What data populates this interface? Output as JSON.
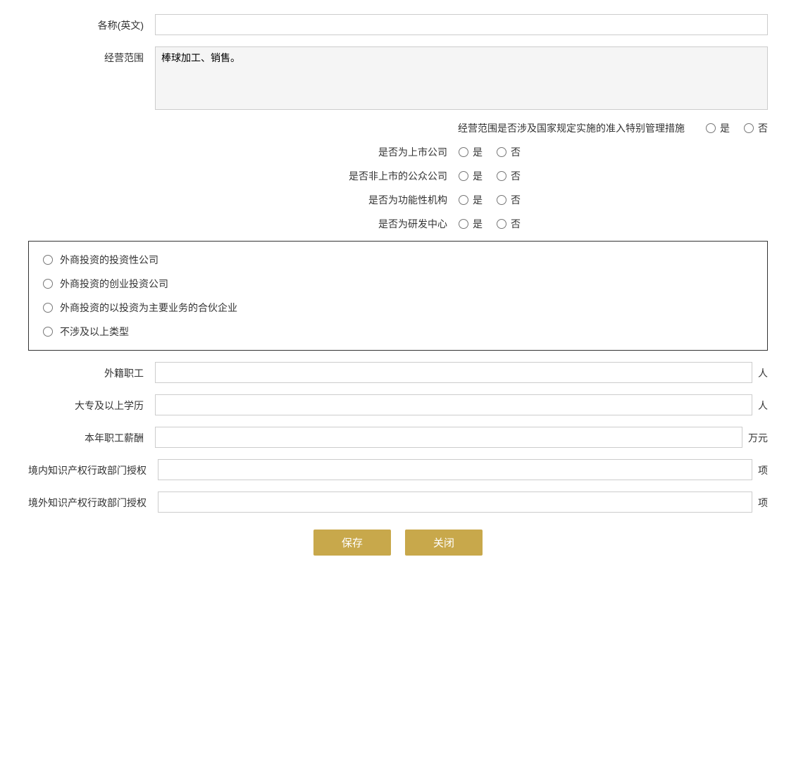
{
  "form": {
    "english_name_label": "各称(英文)",
    "english_name_value": "",
    "business_scope_label": "经营范围",
    "business_scope_value": "棒球加工、销售。",
    "special_mgmt_label": "经营范围是否涉及国家规定实施的准入特别管理措施",
    "special_mgmt_yes": "是",
    "special_mgmt_no": "否",
    "listed_company_label": "是否为上市公司",
    "listed_yes": "是",
    "listed_no": "否",
    "non_listed_public_label": "是否非上市的公众公司",
    "non_listed_yes": "是",
    "non_listed_no": "否",
    "functional_org_label": "是否为功能性机构",
    "functional_yes": "是",
    "functional_no": "否",
    "rd_center_label": "是否为研发中心",
    "rd_yes": "是",
    "rd_no": "否",
    "foreign_investment_options": [
      "外商投资的投资性公司",
      "外商投资的创业投资公司",
      "外商投资的以投资为主要业务的合伙企业",
      "不涉及以上类型"
    ],
    "foreign_staff_label": "外籍职工",
    "foreign_staff_value": "",
    "foreign_staff_unit": "人",
    "college_edu_label": "大专及以上学历",
    "college_edu_value": "",
    "college_edu_unit": "人",
    "annual_salary_label": "本年职工薪酬",
    "annual_salary_value": "",
    "annual_salary_unit": "万元",
    "domestic_ip_label": "境内知识产权行政部门授权",
    "domestic_ip_value": "",
    "domestic_ip_unit": "项",
    "foreign_ip_label": "境外知识产权行政部门授权",
    "foreign_ip_value": "",
    "foreign_ip_unit": "项",
    "save_button": "保存",
    "close_button": "关闭"
  }
}
